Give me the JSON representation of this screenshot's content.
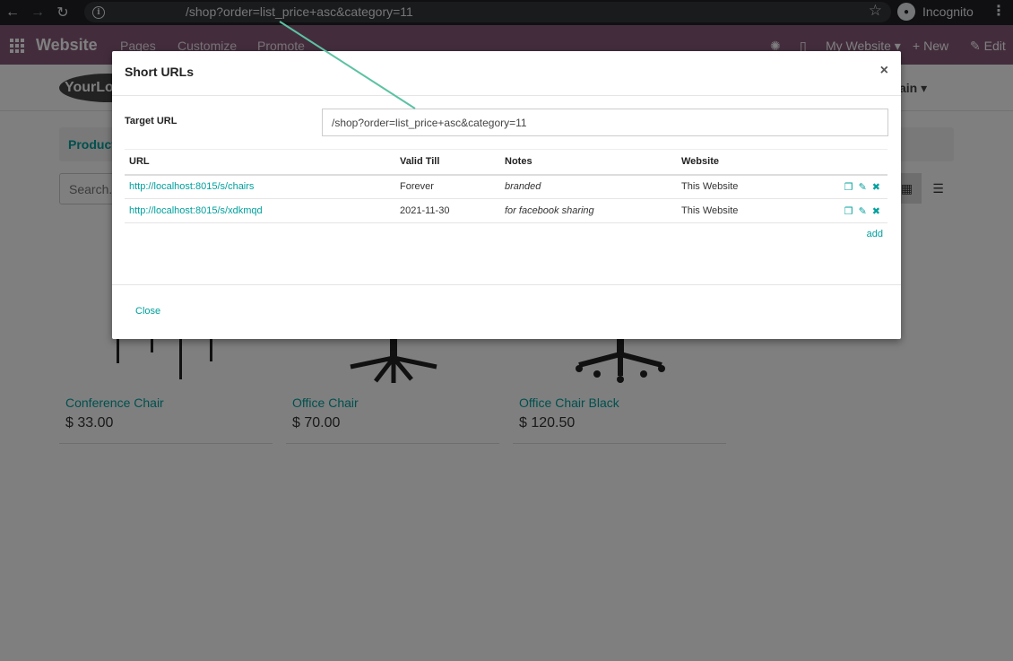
{
  "browser": {
    "url": "/shop?order=list_price+asc&category=11",
    "incognito_label": "Incognito",
    "icons": {
      "back": "back-arrow-icon",
      "forward": "forward-arrow-icon",
      "reload": "reload-icon",
      "info": "info-icon",
      "star": "star-icon",
      "menu": "kebab-menu-icon"
    }
  },
  "odoo_bar": {
    "brand": "Website",
    "menu": [
      "Pages",
      "Customize",
      "Promote"
    ],
    "my_website": "My Website",
    "new_label": "New",
    "edit_label": "Edit",
    "color": "#875a7b"
  },
  "site": {
    "logo_text": "YourLo",
    "main_menu": "ain",
    "breadcrumb": "Products",
    "search_placeholder": "Search..."
  },
  "products": [
    {
      "name": "Conference Chair",
      "price": "$ 33.00"
    },
    {
      "name": "Office Chair",
      "price": "$ 70.00"
    },
    {
      "name": "Office Chair Black",
      "price": "$ 120.50"
    }
  ],
  "modal": {
    "title": "Short URLs",
    "close_symbol": "×",
    "target_label": "Target URL",
    "target_value": "/shop?order=list_price+asc&category=11",
    "columns": {
      "url": "URL",
      "valid_till": "Valid Till",
      "notes": "Notes",
      "website": "Website"
    },
    "rows": [
      {
        "url": "http://localhost:8015/s/chairs",
        "valid_till": "Forever",
        "notes": "branded",
        "website": "This Website"
      },
      {
        "url": "http://localhost:8015/s/xdkmqd",
        "valid_till": "2021-11-30",
        "notes": "for facebook sharing",
        "website": "This Website"
      }
    ],
    "add_label": "add",
    "close_label": "Close",
    "accent": "#00a09d"
  }
}
